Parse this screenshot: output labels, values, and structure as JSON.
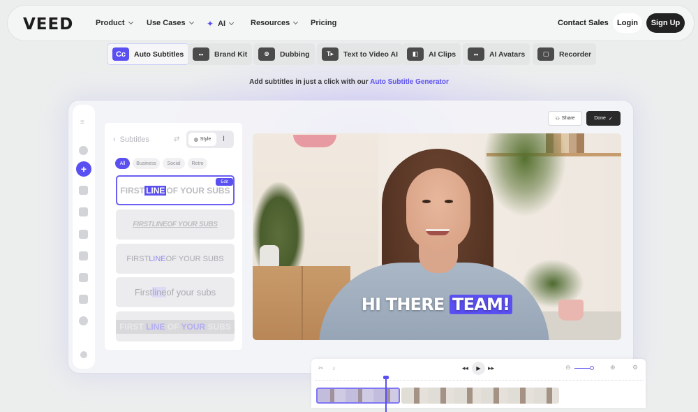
{
  "brand": {
    "logo": "VEED",
    "accent": "#5a4ff0"
  },
  "nav": {
    "items": [
      {
        "label": "Product"
      },
      {
        "label": "Use Cases"
      },
      {
        "label": "AI"
      },
      {
        "label": "Resources"
      },
      {
        "label": "Pricing"
      }
    ],
    "contact": "Contact Sales",
    "login": "Login",
    "signup": "Sign Up"
  },
  "tools": [
    {
      "label": "Auto Subtitles",
      "icon": "Cc"
    },
    {
      "label": "Brand Kit",
      "icon": "brand-kit-icon"
    },
    {
      "label": "Dubbing",
      "icon": "globe-icon"
    },
    {
      "label": "Text to Video AI",
      "icon": "text-video-icon"
    },
    {
      "label": "AI Clips",
      "icon": "clips-icon"
    },
    {
      "label": "AI Avatars",
      "icon": "avatar-icon"
    },
    {
      "label": "Recorder",
      "icon": "recorder-icon"
    }
  ],
  "tagline": {
    "text": "Add subtitles in just a click with our ",
    "link": "Auto Subtitle Generator"
  },
  "editor": {
    "panel_title": "Subtitles",
    "style_label": "Style",
    "chips": [
      "All",
      "Business",
      "Social",
      "Retro"
    ],
    "edit_badge": "Edit",
    "cards": [
      {
        "pre": "FIRST ",
        "hl": "LINE",
        "post": " OF YOUR SUBS"
      },
      {
        "pre": "FIRST ",
        "hl": "LINE",
        "post": " OF YOUR SUBS"
      },
      {
        "pre": "FIRST ",
        "hl": "LINE",
        "post": " OF YOUR SUBS"
      },
      {
        "pre": "First ",
        "hl": "line",
        "post": " of your subs"
      },
      {
        "pre": "FIRST ",
        "hl": "LINE",
        "mid": " OF ",
        "hl2": "YOUR",
        "post": " SUBS"
      }
    ],
    "share": "Share",
    "done": "Done",
    "caption": {
      "pre": "HI THERE ",
      "hl": "TEAM!"
    }
  }
}
